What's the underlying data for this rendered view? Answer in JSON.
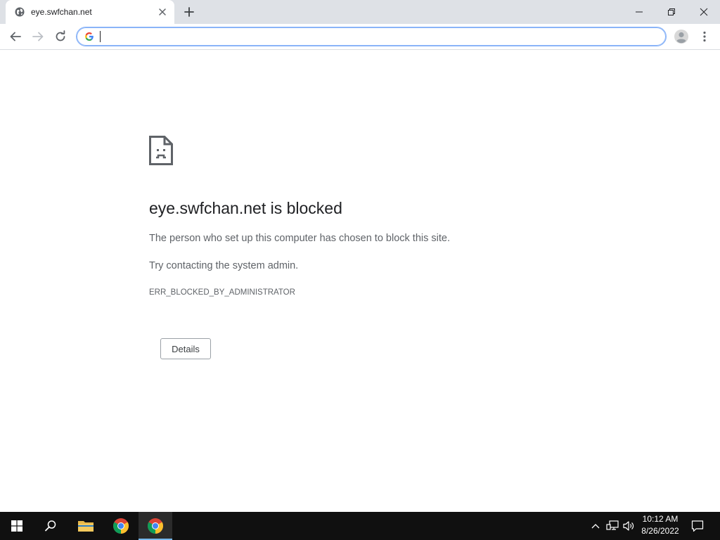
{
  "browser": {
    "tab_title": "eye.swfchan.net",
    "omnibox_value": "",
    "omnibox_placeholder": ""
  },
  "error_page": {
    "heading": "eye.swfchan.net is blocked",
    "message": "The person who set up this computer has chosen to block this site.",
    "suggestion": "Try contacting the system admin.",
    "error_code": "ERR_BLOCKED_BY_ADMINISTRATOR",
    "details_label": "Details"
  },
  "taskbar": {
    "time": "10:12 AM",
    "date": "8/26/2022"
  },
  "icons": {
    "tab_favicon": "globe-icon",
    "tab_close": "close-icon",
    "new_tab": "plus-icon",
    "back": "arrow-left-icon",
    "forward": "arrow-right-icon",
    "reload": "reload-icon",
    "omnibox": "google-g-icon",
    "profile": "avatar-icon",
    "menu": "kebab-menu-icon",
    "error": "sad-document-icon"
  },
  "colors": {
    "tabstrip_bg": "#dee1e6",
    "omnibox_focus": "#8ab4f8",
    "heading_text": "#202124",
    "body_text": "#5f6368",
    "taskbar_bg": "#101010",
    "active_indicator": "#76b9ed"
  }
}
